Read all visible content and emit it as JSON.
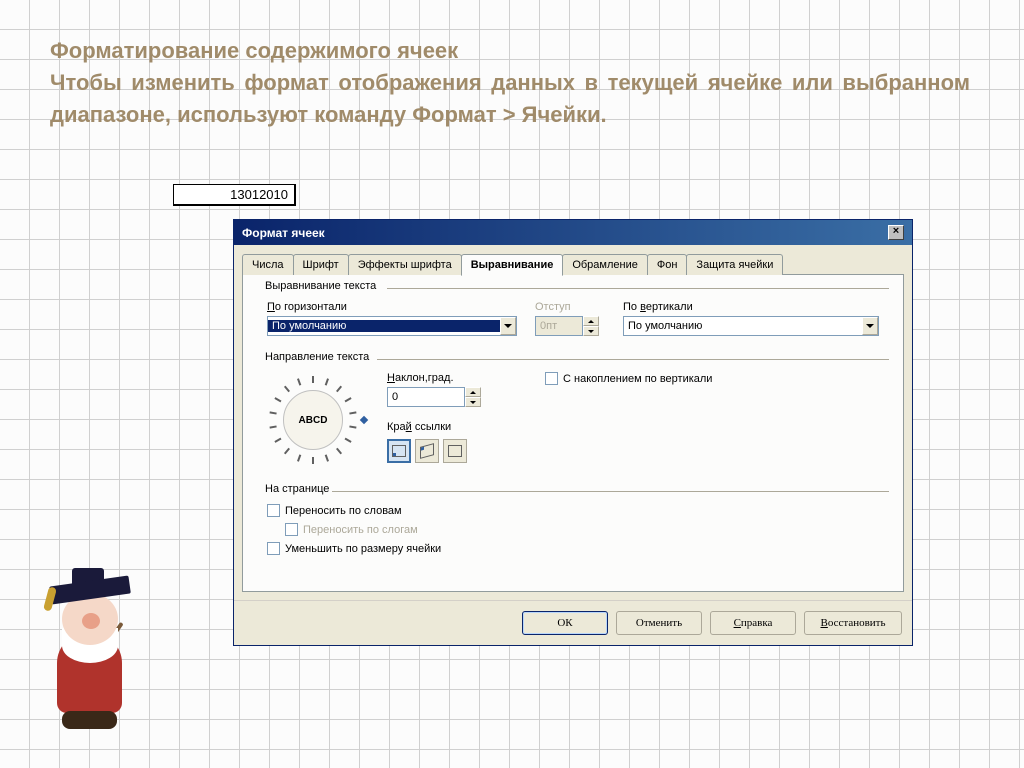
{
  "slide": {
    "title": "Форматирование содержимого ячеек",
    "body": "Чтобы изменить формат отображения данных в текущей ячейке или выбранном диапазоне, используют команду Формат > Ячейки."
  },
  "cell_value": "13012010",
  "dialog": {
    "title": "Формат ячеек",
    "tabs": [
      "Числа",
      "Шрифт",
      "Эффекты шрифта",
      "Выравнивание",
      "Обрамление",
      "Фон",
      "Защита ячейки"
    ],
    "active_tab": 3,
    "alignment": {
      "section_label": "Выравнивание текста",
      "horizontal_label": "По горизонтали",
      "horizontal_value": "По умолчанию",
      "indent_label": "Отступ",
      "indent_value": "0пт",
      "vertical_label": "По вертикали",
      "vertical_value": "По умолчанию"
    },
    "direction": {
      "section_label": "Направление текста",
      "dial_text": "ABCD",
      "angle_label": "Наклон,град.",
      "angle_value": "0",
      "stacking_label": "С накоплением по вертикали",
      "edge_label": "Край ссылки"
    },
    "page": {
      "section_label": "На странице",
      "wrap_label": "Переносить по словам",
      "hyphen_label": "Переносить по слогам",
      "shrink_label": "Уменьшить по размеру ячейки"
    },
    "buttons": {
      "ok": "ОК",
      "cancel": "Отменить",
      "help": "Справка",
      "reset": "Восстановить"
    }
  }
}
